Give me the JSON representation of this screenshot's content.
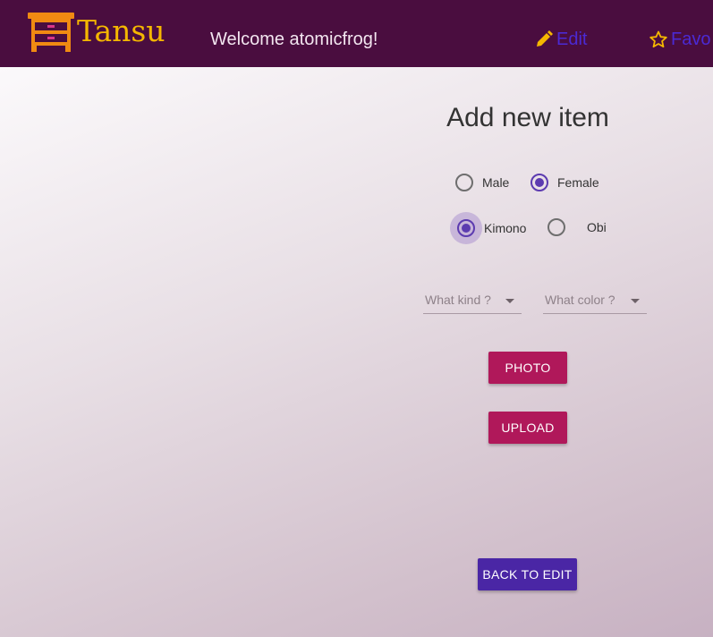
{
  "colors": {
    "topbar": "#4a0d3f",
    "brand": "#f5b700",
    "logo": "#f08a12",
    "nav_link": "#4b2ad4",
    "nav_icon": "#f5b700",
    "primary_button": "#b0185a",
    "secondary_button": "#4a26a5",
    "radio_selected": "#5c3bb0"
  },
  "header": {
    "brand": "Tansu",
    "welcome": "Welcome atomicfrog!",
    "nav": [
      {
        "label": "Edit",
        "icon": "pencil-icon"
      },
      {
        "label": "Favo",
        "icon": "star-icon"
      }
    ]
  },
  "form": {
    "title": "Add new item",
    "gender": {
      "options": [
        "Male",
        "Female"
      ],
      "selected": "Female"
    },
    "type": {
      "options": [
        "Kimono",
        "Obi"
      ],
      "selected": "Kimono"
    },
    "kind_select": {
      "placeholder": "What kind ?"
    },
    "color_select": {
      "placeholder": "What color ?"
    },
    "photo_button": "PHOTO",
    "upload_button": "UPLOAD",
    "back_button": "BACK TO EDIT"
  }
}
